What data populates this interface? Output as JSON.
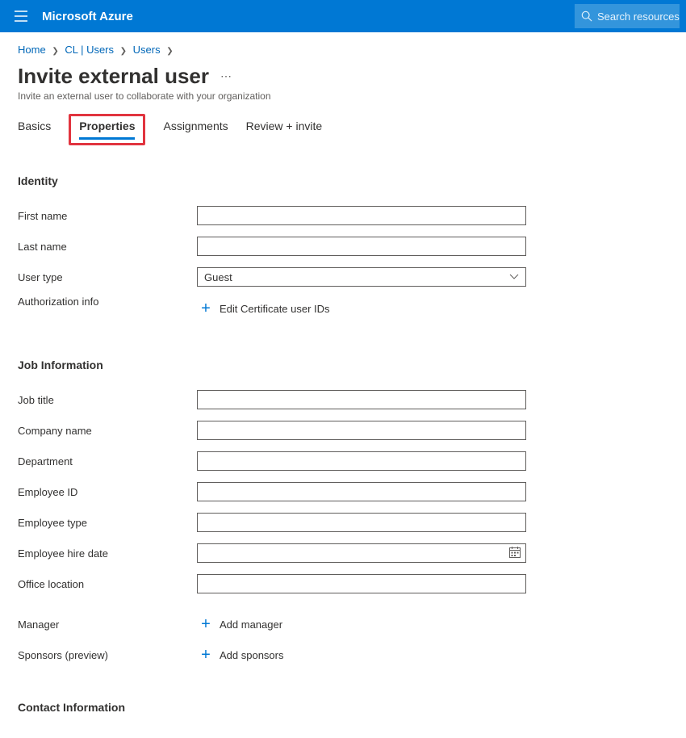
{
  "header": {
    "brand": "Microsoft Azure",
    "search_placeholder": "Search resources"
  },
  "breadcrumb": {
    "items": [
      "Home",
      "CL | Users",
      "Users"
    ]
  },
  "page": {
    "title": "Invite external user",
    "subtitle": "Invite an external user to collaborate with your organization"
  },
  "tabs": {
    "items": [
      "Basics",
      "Properties",
      "Assignments",
      "Review + invite"
    ],
    "active_index": 1
  },
  "sections": {
    "identity": {
      "title": "Identity",
      "first_name_label": "First name",
      "last_name_label": "Last name",
      "user_type_label": "User type",
      "user_type_value": "Guest",
      "auth_info_label": "Authorization info",
      "edit_cert_label": "Edit Certificate user IDs"
    },
    "job": {
      "title": "Job Information",
      "job_title_label": "Job title",
      "company_label": "Company name",
      "department_label": "Department",
      "employee_id_label": "Employee ID",
      "employee_type_label": "Employee type",
      "hire_date_label": "Employee hire date",
      "office_location_label": "Office location",
      "manager_label": "Manager",
      "add_manager_label": "Add manager",
      "sponsors_label": "Sponsors (preview)",
      "add_sponsors_label": "Add sponsors"
    },
    "contact": {
      "title": "Contact Information"
    }
  }
}
